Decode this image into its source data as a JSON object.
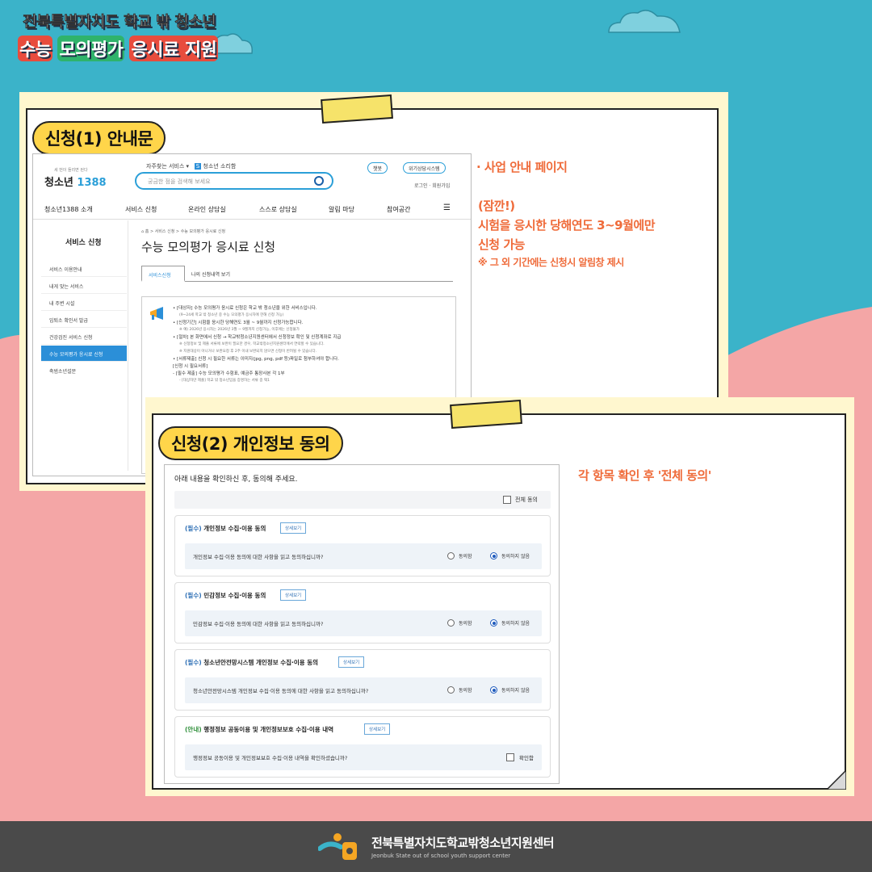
{
  "header": {
    "line1": "전북특별자치도 학교 밖 청소년",
    "line2_a": "수능",
    "line2_b": "모의평가",
    "line2_c": "응시료 지원"
  },
  "section1": {
    "badge": "신청(1) 안내문",
    "note_title": "· 사업 안내 페이지",
    "note_warn1": "(잠깐!)",
    "note_warn2": "시험을 응시한 당해연도 3~9월에만",
    "note_warn3": "신청 가능",
    "note_warn4": "※ 그 외 기간에는 신청시 알림창 제시"
  },
  "site": {
    "toplinks": "자주찾는 서비스",
    "toplink_org": "청소년 소리함",
    "logo_sub": "세 번이 들리면 된다",
    "logo_text": "청소년",
    "logo_num": "1388",
    "search_placeholder": "궁금한 점을 검색해 보세요",
    "pill_a": "챗봇",
    "pill_b": "위기상담시스템",
    "login": "로그인 · 회원가입",
    "nav": [
      "청소년1388 소개",
      "서비스 신청",
      "온라인 상담실",
      "스스로 상담실",
      "알림 마당",
      "참여공간",
      "☰"
    ],
    "side_title": "서비스 신청",
    "side_items": [
      "서비스 이용안내",
      "내게 맞는 서비스",
      "내 주변 시설",
      "입퇴소 확인서 발급",
      "건강검진 서비스 신청",
      "수능 모의평가 응시료 신청",
      "축범소년설문"
    ],
    "breadcrumb": "⌂ 홈 > 서비스 신청 > 수능 모의평가 응시료 신청",
    "page_title": "수능 모의평가 응시료 신청",
    "tab_active": "서비스신청",
    "tab_other": "나의 신청내역 보기",
    "lines": [
      "• [대상자] 수능 모의평가 응시료 신청은 학교 밖 청소년을 위한 서비스입니다.",
      "(9~24세 학교 밖 청소년 중 수능 모의평가 응시자에 한해 신청 가능)",
      "• [신청기간] 시험을 응시한 당해연도 3월 ~ 9월까지 신청가능합니다.",
      "※ 예) 2026년 응시자는 2026년 3월 ~ 9월까지 신청가능, 이후에는 신청불가",
      "• [절차] 본 화면에서 신청 → 학교밖청소년지원센터에서 신청정보 확인 및 신청계좌로 지급",
      "※ 신청정보 및 제출 서류에 보완이 필요한 경우, 학교밖청소년지원센터에서 연락할 수 있습니다.",
      "※ 지원대상이 아니거나 보완요청 후 2주 이내 보완되지 않으면 신청이 반려될 수 있습니다.",
      "• [서류제출] 신청 시 필요한 서류는 이미지(jpg, png, pdf 등)파일로 첨부하셔야 합니다.",
      "[신청 시 필요서류]",
      "- [필수 제출] 수능 모의평가 수험표, 예금주 통장사본 각 1부",
      "- [대상자만 제출] 학교 밖 청소년임을 증명하는 서류 중 택1"
    ]
  },
  "section2": {
    "badge": "신청(2) 개인정보 동의",
    "note": "각 항목 확인 후 '전체 동의'",
    "head": "아래 내용을 확인하신 후, 동의해 주세요.",
    "all_agree": "전체 동의",
    "detail": "상세보기",
    "agree": "동의함",
    "disagree": "동의하지 않음",
    "confirm": "확인함",
    "cards": [
      {
        "tag": "(필수)",
        "title": "개인정보 수집·이용 동의",
        "question": "개인정보 수집·이용 동의에 대한 사항을 읽고 동의하십니까?"
      },
      {
        "tag": "(필수)",
        "title": "민감정보 수집·이용 동의",
        "question": "민감정보 수집·이용 동의에 대한 사항을 읽고 동의하십니까?"
      },
      {
        "tag": "(필수)",
        "title": "청소년안전망시스템 개인정보 수집·이용 동의",
        "question": "청소년안전망시스템 개인정보 수집·이용 동의에 대한 사항을 읽고 동의하십니까?"
      },
      {
        "tag": "(안내)",
        "title": "행정정보 공동이용 및 개인정보보호 수집·이용 내역",
        "question": "행정정보 공동이용 및 개인정보보호 수집·이용 내역을 확인하셨습니까?"
      }
    ]
  },
  "footer": {
    "name": "전북특별자치도학교밖청소년지원센터",
    "sub": "Jeonbuk State out of school youth support center"
  },
  "colors": {
    "teal": "#3bb3c9",
    "pink": "#f4a6a6",
    "yellow": "#ffd54a",
    "orange": "#ef6b3a",
    "blue": "#2b8fd8"
  }
}
